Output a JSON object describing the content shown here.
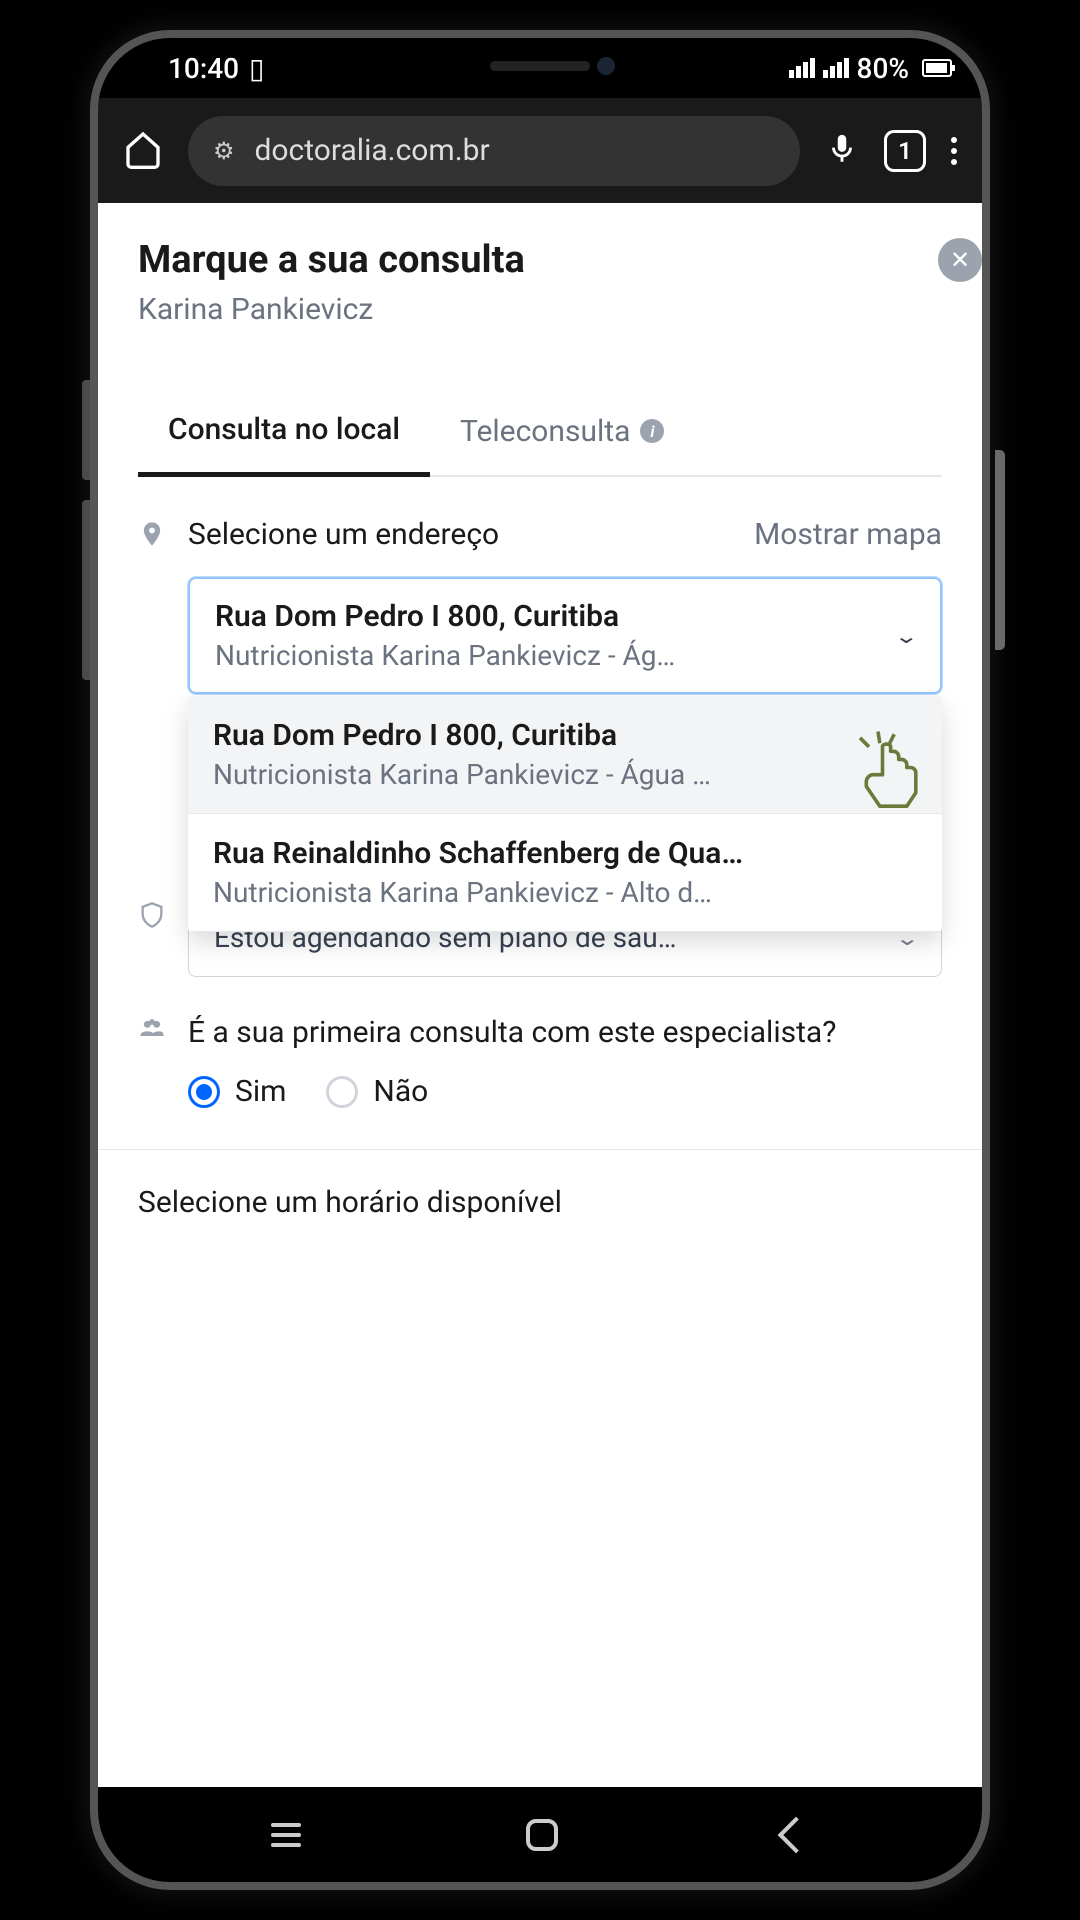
{
  "statusbar": {
    "time": "10:40",
    "battery": "80%"
  },
  "browser": {
    "url": "doctoralia.com.br",
    "tab_count": "1"
  },
  "modal": {
    "title": "Marque a sua consulta",
    "subtitle": "Karina Pankievicz"
  },
  "tabs": {
    "local": "Consulta no local",
    "tele": "Teleconsulta"
  },
  "address": {
    "label": "Selecione um endereço",
    "show_map": "Mostrar mapa",
    "selected": {
      "line1": "Rua Dom Pedro I 800, Curitiba",
      "line2": "Nutricionista Karina Pankievicz - Ág…"
    },
    "options": [
      {
        "line1": "Rua Dom Pedro I 800, Curitiba",
        "line2": "Nutricionista Karina Pankievicz - Água …"
      },
      {
        "line1": "Rua Reinaldinho Schaffenberg de Qua…",
        "line2": "Nutricionista Karina Pankievicz - Alto d…"
      }
    ]
  },
  "insurance": {
    "selected": "Estou agendando sem plano de saú…"
  },
  "first_visit": {
    "question": "É a sua primeira consulta com este especialista?",
    "yes": "Sim",
    "no": "Não"
  },
  "schedule": {
    "label": "Selecione um horário disponível"
  }
}
